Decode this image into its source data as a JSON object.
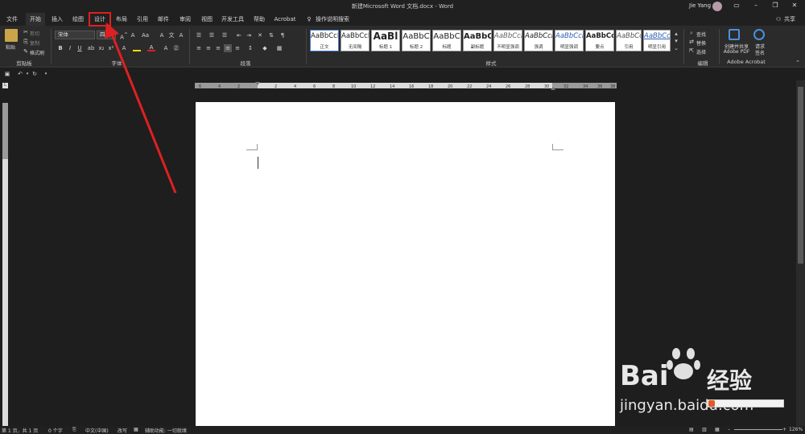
{
  "window": {
    "title": "新建Microsoft Word 文档.docx - Word",
    "user_name": "Jie Yang",
    "share_label": "共享"
  },
  "tabs": [
    "文件",
    "开始",
    "插入",
    "绘图",
    "设计",
    "布局",
    "引用",
    "邮件",
    "审阅",
    "视图",
    "开发工具",
    "帮助",
    "Acrobat"
  ],
  "active_tab": "开始",
  "highlighted_tab": "设计",
  "tell_me": "操作说明搜索",
  "ribbon": {
    "clipboard": {
      "label": "剪贴板",
      "paste": "粘贴",
      "cut": "剪切",
      "copy": "复制",
      "format_painter": "格式刷"
    },
    "font": {
      "label": "字体",
      "font_name": "宋体",
      "font_size": "四号",
      "case_button": "Aa"
    },
    "paragraph": {
      "label": "段落"
    },
    "styles": {
      "label": "样式",
      "tiles": [
        {
          "sample": "AaBbCcI",
          "name": "正文"
        },
        {
          "sample": "AaBbCcI",
          "name": "无间隔"
        },
        {
          "sample": "AaBl",
          "name": "标题 1"
        },
        {
          "sample": "AaBbC",
          "name": "标题 2"
        },
        {
          "sample": "AaBbC",
          "name": "标题"
        },
        {
          "sample": "AaBbC",
          "name": "副标题"
        },
        {
          "sample": "AaBbCcI",
          "name": "不明显强调"
        },
        {
          "sample": "AaBbCcI",
          "name": "强调"
        },
        {
          "sample": "AaBbCcI",
          "name": "明显强调"
        },
        {
          "sample": "AaBbCcI",
          "name": "要点"
        },
        {
          "sample": "AaBbCcI",
          "name": "引用"
        },
        {
          "sample": "AaBbCcI",
          "name": "明显引用"
        }
      ]
    },
    "editing": {
      "label": "编辑",
      "find": "查找",
      "replace": "替换",
      "select": "选择"
    },
    "acrobat": {
      "label": "Adobe Acrobat",
      "create_share": "创建并共享",
      "create_share_2": "Adobe PDF",
      "request_sign": "请求",
      "request_sign_2": "签名"
    }
  },
  "ruler": {
    "h_ticks": [
      "6",
      "4",
      "2",
      "2",
      "4",
      "6",
      "8",
      "10",
      "12",
      "14",
      "16",
      "18",
      "20",
      "22",
      "24",
      "26",
      "28",
      "30",
      "32",
      "34",
      "36",
      "38"
    ]
  },
  "status": {
    "page": "第 1 页，共 1 页",
    "words": "0 个字",
    "language": "中文(中国)",
    "track": "改写",
    "accessibility": "辅助功能: 一切就绪",
    "zoom": "126%"
  },
  "watermark": {
    "brand": "Bai",
    "brand_cn": "经验",
    "url": "jingyan.baidu.com"
  },
  "colors": {
    "annotation": "#e02020",
    "ribbon_bg": "#2b2b2b",
    "page": "#ffffff"
  }
}
